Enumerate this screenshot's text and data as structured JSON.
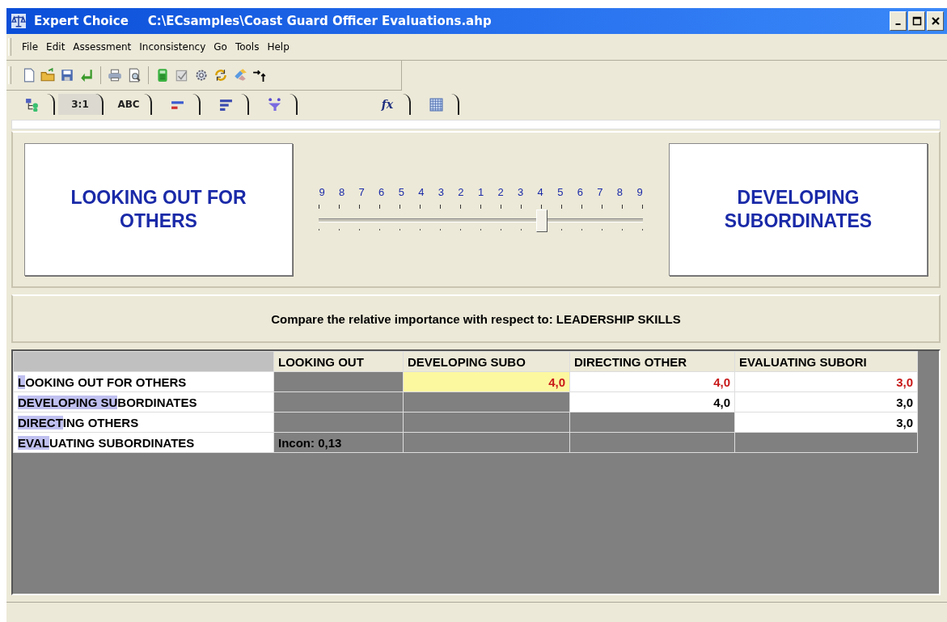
{
  "window": {
    "title": "Expert Choice",
    "file_path": "C:\\ECsamples\\Coast Guard Officer Evaluations.ahp"
  },
  "menu": [
    "File",
    "Edit",
    "Assessment",
    "Inconsistency",
    "Go",
    "Tools",
    "Help"
  ],
  "tabs": [
    {
      "kind": "icon",
      "selected": false
    },
    {
      "kind": "text",
      "label": "3:1",
      "selected": true
    },
    {
      "kind": "text",
      "label": "ABC",
      "selected": false
    },
    {
      "kind": "icon",
      "selected": false
    },
    {
      "kind": "icon",
      "selected": false
    },
    {
      "kind": "icon",
      "selected": false
    },
    {
      "kind": "gap"
    },
    {
      "kind": "formula",
      "label": "fx",
      "selected": false
    },
    {
      "kind": "icon",
      "selected": false
    }
  ],
  "comparison": {
    "left": "LOOKING OUT FOR OTHERS",
    "right": "DEVELOPING SUBORDINATES",
    "scale": [
      "9",
      "8",
      "7",
      "6",
      "5",
      "4",
      "3",
      "2",
      "1",
      "2",
      "3",
      "4",
      "5",
      "6",
      "7",
      "8",
      "9"
    ],
    "level": 0.6875
  },
  "prompt": "Compare the relative importance with respect to: LEADERSHIP SKILLS",
  "table": {
    "columns": [
      "LOOKING OUT",
      "DEVELOPING SUBO",
      "DIRECTING OTHER",
      "EVALUATING SUBORI"
    ],
    "rows": [
      {
        "highlight": "L",
        "rest": "OOKING OUT FOR OTHERS",
        "cells": [
          {
            "kind": "blank"
          },
          {
            "kind": "value",
            "text": "4,0",
            "inverse": true,
            "selected": true
          },
          {
            "kind": "value",
            "text": "4,0",
            "inverse": true,
            "selected": false
          },
          {
            "kind": "value",
            "text": "3,0",
            "inverse": true,
            "selected": false
          }
        ]
      },
      {
        "highlight": "DEVELOPING SU",
        "rest": "BORDINATES",
        "cells": [
          {
            "kind": "blank"
          },
          {
            "kind": "blank"
          },
          {
            "kind": "value",
            "text": "4,0",
            "inverse": false,
            "selected": false
          },
          {
            "kind": "value",
            "text": "3,0",
            "inverse": false,
            "selected": false
          }
        ]
      },
      {
        "highlight": "DIRECT",
        "rest": "ING OTHERS",
        "cells": [
          {
            "kind": "blank"
          },
          {
            "kind": "blank"
          },
          {
            "kind": "blank"
          },
          {
            "kind": "value",
            "text": "3,0",
            "inverse": false,
            "selected": false
          }
        ]
      },
      {
        "highlight": "EVAL",
        "rest": "UATING SUBORDINATES",
        "cells": [
          {
            "kind": "note",
            "text": "Incon: 0,13"
          },
          {
            "kind": "blank"
          },
          {
            "kind": "blank"
          },
          {
            "kind": "blank"
          }
        ]
      }
    ]
  }
}
